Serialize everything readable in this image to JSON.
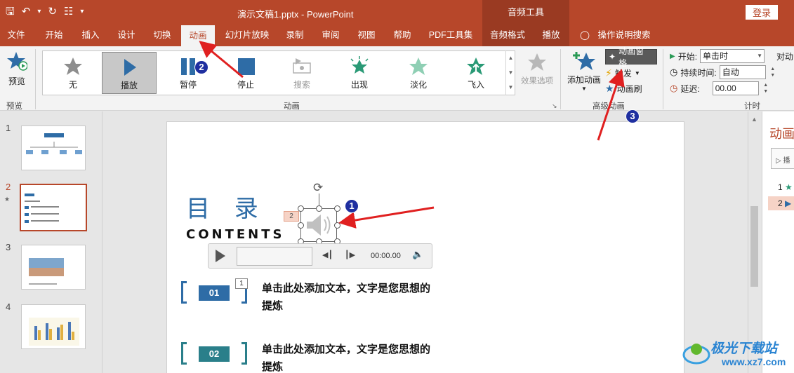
{
  "titlebar": {
    "doc_title": "演示文稿1.pptx  -  PowerPoint",
    "context_tools": "音频工具",
    "login_label": "登录",
    "bg_color": "#b7472a"
  },
  "tabs": [
    {
      "label": "文件"
    },
    {
      "label": "开始"
    },
    {
      "label": "插入"
    },
    {
      "label": "设计"
    },
    {
      "label": "切换"
    },
    {
      "label": "动画",
      "active": true
    },
    {
      "label": "幻灯片放映"
    },
    {
      "label": "录制"
    },
    {
      "label": "审阅"
    },
    {
      "label": "视图"
    },
    {
      "label": "帮助"
    },
    {
      "label": "PDF工具集"
    },
    {
      "label": "音频格式"
    },
    {
      "label": "播放"
    },
    {
      "label": "操作说明搜索"
    }
  ],
  "ribbon": {
    "preview": {
      "label": "预览",
      "group": "预览"
    },
    "gallery": [
      {
        "label": "无"
      },
      {
        "label": "播放",
        "selected": true
      },
      {
        "label": "暂停"
      },
      {
        "label": "停止"
      },
      {
        "label": "搜索",
        "disabled": true
      },
      {
        "label": "出现"
      },
      {
        "label": "淡化"
      },
      {
        "label": "飞入"
      }
    ],
    "effect_options": "效果选项",
    "animation_group": "动画",
    "add_animation": "添加动画",
    "animation_pane": "动画窗格",
    "trigger": "触发",
    "animation_painter": "动画刷",
    "advanced_group": "高级动画",
    "timing": {
      "start_label": "开始:",
      "start_value": "单击时",
      "duration_label": "持续时间:",
      "duration_value": "自动",
      "delay_label": "延迟:",
      "delay_value": "00.00",
      "group": "计时"
    },
    "reorder": "对动"
  },
  "slides": [
    {
      "num": "1"
    },
    {
      "num": "2",
      "active": true
    },
    {
      "num": "3"
    },
    {
      "num": "4"
    }
  ],
  "slide": {
    "title": "目 录",
    "subtitle": "CONTENTS",
    "speaker_tag": "2",
    "item_tag": "1",
    "player_time": "00:00.00",
    "items": [
      {
        "num": "01",
        "text": "单击此处添加文本，文字是您思想的提炼"
      },
      {
        "num": "02",
        "text": "单击此处添加文本，文字是您思想的提炼"
      }
    ],
    "accent": "#2e6ca6"
  },
  "anim_pane": {
    "title": "动画",
    "play_label": "播",
    "rows": [
      {
        "num": "1"
      },
      {
        "num": "2",
        "selected": true
      }
    ]
  },
  "badges": [
    "1",
    "2",
    "3"
  ],
  "watermark": {
    "text": "极光下载站",
    "url": "www.xz7.com"
  }
}
